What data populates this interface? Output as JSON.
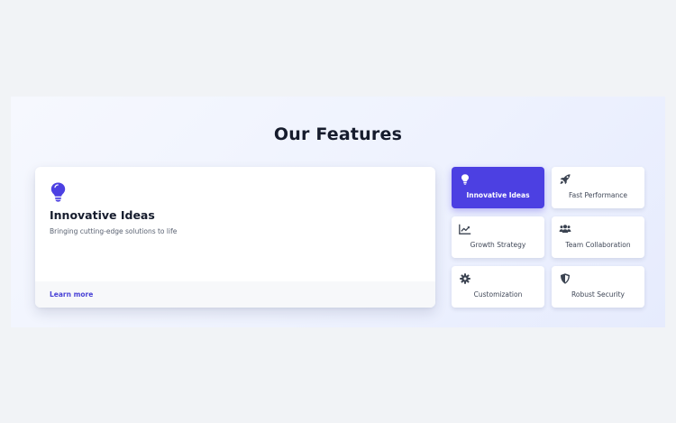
{
  "page": {
    "title": "Our Features"
  },
  "colors": {
    "accent": "#4c40e2",
    "text_dark": "#161c2d",
    "link": "#4a43d6"
  },
  "detail": {
    "icon": "lightbulb-icon",
    "heading": "Innovative Ideas",
    "description": "Bringing cutting-edge solutions to life",
    "link_label": "Learn more"
  },
  "features": [
    {
      "label": "Innovative Ideas",
      "icon": "lightbulb-icon",
      "active": true
    },
    {
      "label": "Fast Performance",
      "icon": "rocket-icon",
      "active": false
    },
    {
      "label": "Growth Strategy",
      "icon": "chart-line-icon",
      "active": false
    },
    {
      "label": "Team Collaboration",
      "icon": "users-icon",
      "active": false
    },
    {
      "label": "Customization",
      "icon": "gear-icon",
      "active": false
    },
    {
      "label": "Robust Security",
      "icon": "shield-icon",
      "active": false
    }
  ]
}
